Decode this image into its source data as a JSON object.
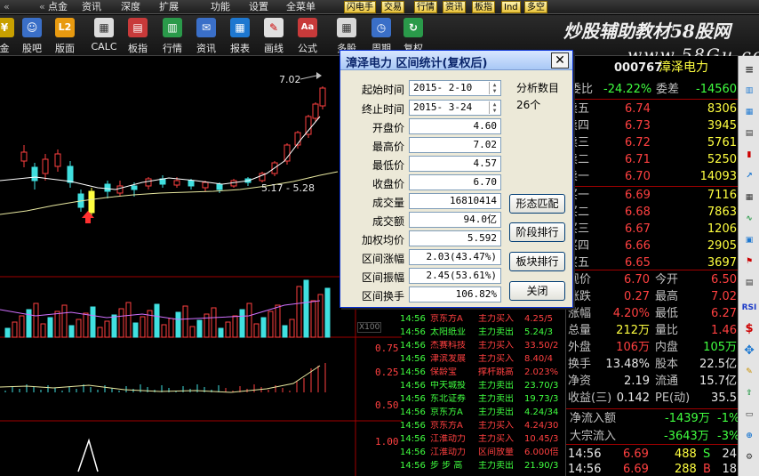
{
  "menubar": {
    "items": [
      "点金",
      "资讯",
      "深度",
      "扩展",
      "功能",
      "设置",
      "全菜单"
    ],
    "quick_buttons": [
      "闪电手",
      "交易",
      "行情",
      "资讯",
      "板指",
      "Ind",
      "多空"
    ]
  },
  "toolbar": {
    "items": [
      {
        "label": "金",
        "icon": "gold-icon"
      },
      {
        "label": "股吧",
        "icon": "people-icon"
      },
      {
        "label": "版面",
        "icon": "l2-icon"
      },
      {
        "label": "CALC",
        "icon": "calculator-icon"
      },
      {
        "label": "板指",
        "icon": "board-index-icon"
      },
      {
        "label": "行情",
        "icon": "quote-icon"
      },
      {
        "label": "资讯",
        "icon": "news-icon"
      },
      {
        "label": "报表",
        "icon": "report-icon"
      },
      {
        "label": "画线",
        "icon": "draw-line-icon"
      },
      {
        "label": "公式",
        "icon": "formula-icon"
      },
      {
        "label": "多股",
        "icon": "multi-stock-icon"
      },
      {
        "label": "周期",
        "icon": "period-icon"
      },
      {
        "label": "复权",
        "icon": "adjust-icon"
      }
    ],
    "l2_badge": "L2",
    "formula_badge": "Aa"
  },
  "watermark": {
    "line1": "炒股辅助教材58股网",
    "line2": "www.58Gu.com"
  },
  "chart": {
    "price_high_label": "7.02",
    "ma_label": "5.17 - 5.28",
    "scale_x100": "X100",
    "axis": [
      "0.75",
      "0.50",
      "0.25",
      "1.00"
    ]
  },
  "stock": {
    "code": "000767",
    "name": "漳泽电力"
  },
  "quote": {
    "weibi_label": "委比",
    "weibi_value": "-24.22%",
    "weicha_label": "委差",
    "weicha_value": "-14560",
    "sell": [
      {
        "label": "卖五",
        "price": "6.74",
        "vol": "8306"
      },
      {
        "label": "卖四",
        "price": "6.73",
        "vol": "3945"
      },
      {
        "label": "卖三",
        "price": "6.72",
        "vol": "5761"
      },
      {
        "label": "卖二",
        "price": "6.71",
        "vol": "5250"
      },
      {
        "label": "卖一",
        "price": "6.70",
        "vol": "14093"
      }
    ],
    "buy": [
      {
        "label": "买一",
        "price": "6.69",
        "vol": "7116"
      },
      {
        "label": "买二",
        "price": "6.68",
        "vol": "7863"
      },
      {
        "label": "买三",
        "price": "6.67",
        "vol": "1206"
      },
      {
        "label": "买四",
        "price": "6.66",
        "vol": "2905"
      },
      {
        "label": "买五",
        "price": "6.65",
        "vol": "3697"
      }
    ],
    "stats": [
      {
        "l1": "现价",
        "v1": "6.70",
        "l2": "今开",
        "v2": "6.50"
      },
      {
        "l1": "涨跌",
        "v1": "0.27",
        "l2": "最高",
        "v2": "7.02"
      },
      {
        "l1": "涨幅",
        "v1": "4.20%",
        "l2": "最低",
        "v2": "6.27"
      },
      {
        "l1": "总量",
        "v1": "212万",
        "l2": "量比",
        "v2": "1.46"
      },
      {
        "l1": "外盘",
        "v1": "106万",
        "l2": "内盘",
        "v2": "105万"
      },
      {
        "l1": "换手",
        "v1": "13.48%",
        "l2": "股本",
        "v2": "22.5亿"
      },
      {
        "l1": "净资",
        "v1": "2.19",
        "l2": "流通",
        "v2": "15.7亿"
      },
      {
        "l1": "收益(三)",
        "v1": "0.142",
        "l2": "PE(动)",
        "v2": "35.5"
      }
    ],
    "netflow_label": "净流入额",
    "netflow_value": "-1439万",
    "netflow_pct": "-1%",
    "bigflow_label": "大宗流入",
    "bigflow_value": "-3643万",
    "bigflow_pct": "-3%",
    "ticks": [
      {
        "time": "14:56",
        "price": "6.69",
        "vol": "488",
        "side": "S",
        "num": "24"
      },
      {
        "time": "14:56",
        "price": "6.69",
        "vol": "288",
        "side": "B",
        "num": "18"
      }
    ]
  },
  "trades": [
    {
      "time": "14:56",
      "name": "京东方A",
      "action": "主力买入",
      "val": "4.25/5"
    },
    {
      "time": "14:56",
      "name": "太阳纸业",
      "action": "主力卖出",
      "val": "5.24/3"
    },
    {
      "time": "14:56",
      "name": "杰赛科技",
      "action": "主力买入",
      "val": "33.50/2"
    },
    {
      "time": "14:56",
      "name": "津滨发展",
      "action": "主力买入",
      "val": "8.40/4"
    },
    {
      "time": "14:56",
      "name": "保龄宝",
      "action": "撑杆跳高",
      "val": "2.023%"
    },
    {
      "time": "14:56",
      "name": "中天城投",
      "action": "主力卖出",
      "val": "23.70/3"
    },
    {
      "time": "14:56",
      "name": "东北证券",
      "action": "主力卖出",
      "val": "19.73/3"
    },
    {
      "time": "14:56",
      "name": "京东方A",
      "action": "主力卖出",
      "val": "4.24/34"
    },
    {
      "time": "14:56",
      "name": "京东方A",
      "action": "主力买入",
      "val": "4.24/30"
    },
    {
      "time": "14:56",
      "name": "江淮动力",
      "action": "主力买入",
      "val": "10.45/3"
    },
    {
      "time": "14:56",
      "name": "江淮动力",
      "action": "区间放量",
      "val": "6.000倍"
    },
    {
      "time": "14:56",
      "name": "步 步 高",
      "action": "主力卖出",
      "val": "21.90/3"
    }
  ],
  "dialog": {
    "title": "漳泽电力  区间统计(复权后)",
    "start_label": "起始时间",
    "start_value": "2015- 2-10",
    "end_label": "终止时间",
    "end_value": "2015- 3-24",
    "count_label": "分析数目",
    "count_value": "26个",
    "rows": [
      {
        "label": "开盘价",
        "value": "4.60"
      },
      {
        "label": "最高价",
        "value": "7.02"
      },
      {
        "label": "最低价",
        "value": "4.57"
      },
      {
        "label": "收盘价",
        "value": "6.70"
      },
      {
        "label": "成交量",
        "value": "16810414"
      },
      {
        "label": "成交额",
        "value": "94.0亿"
      },
      {
        "label": "加权均价",
        "value": "5.592"
      },
      {
        "label": "区间涨幅",
        "value": "2.03(43.47%)"
      },
      {
        "label": "区间振幅",
        "value": "2.45(53.61%)"
      },
      {
        "label": "区间换手",
        "value": "106.82%"
      }
    ],
    "buttons": {
      "match": "形态匹配",
      "stage": "阶段排行",
      "sector": "板块排行",
      "close": "关闭"
    }
  },
  "iconbar": {
    "labels": [
      "RSI",
      "$"
    ]
  }
}
